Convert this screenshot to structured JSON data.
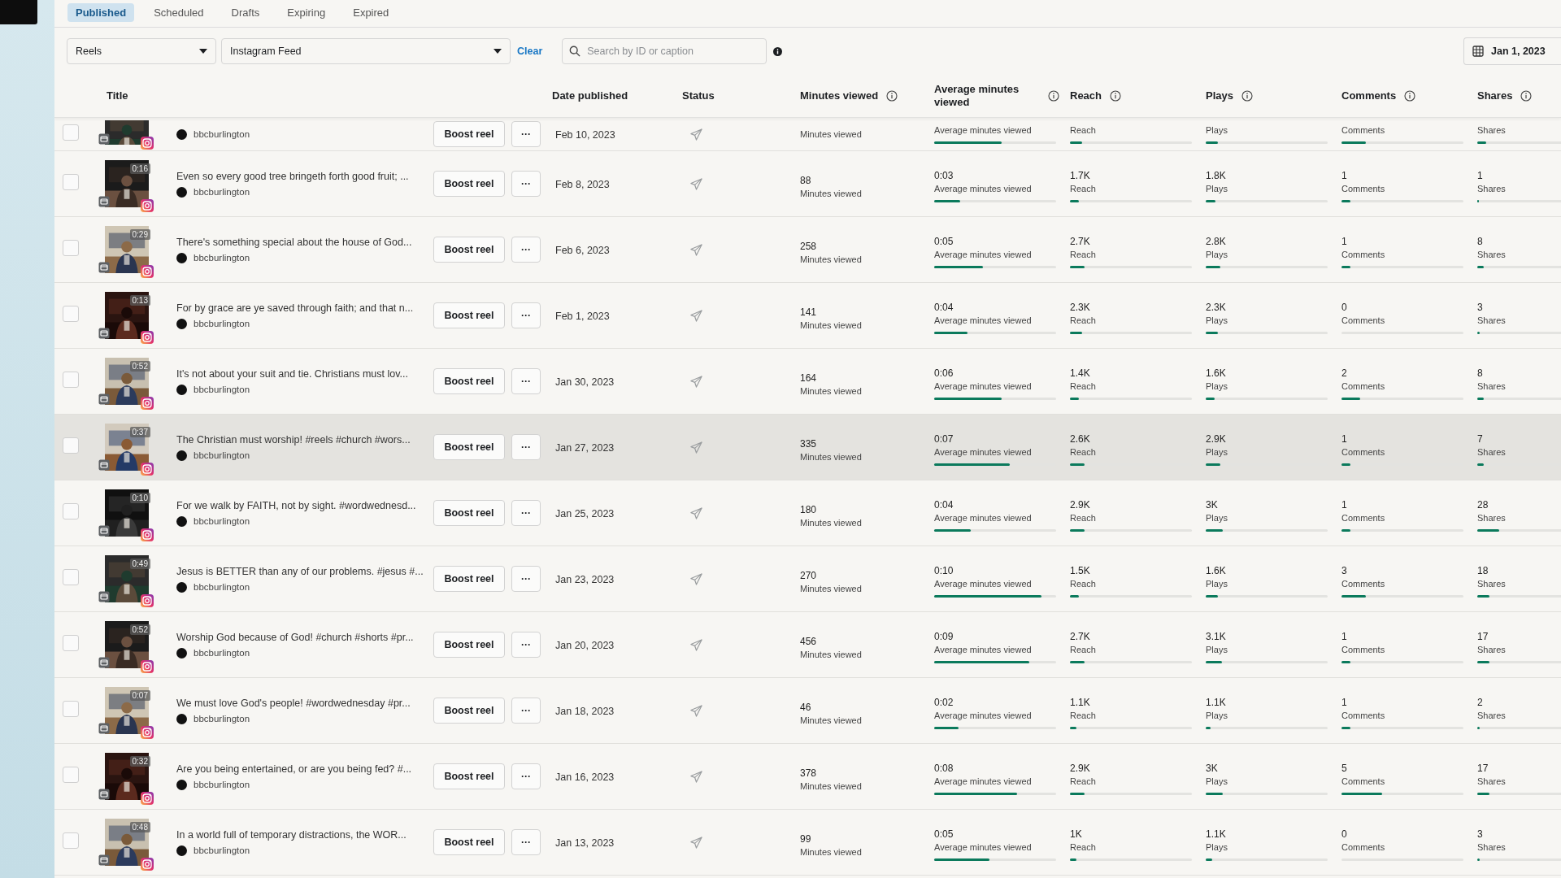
{
  "tabs": [
    {
      "label": "Published",
      "selected": true
    },
    {
      "label": "Scheduled",
      "selected": false
    },
    {
      "label": "Drafts",
      "selected": false
    },
    {
      "label": "Expiring",
      "selected": false
    },
    {
      "label": "Expired",
      "selected": false
    }
  ],
  "filters": {
    "content_type": "Reels",
    "placement": "Instagram Feed",
    "clear": "Clear",
    "search": {
      "placeholder": "Search by ID or caption"
    },
    "date_range": "Jan 1, 2023"
  },
  "columns": [
    {
      "label": "Title",
      "info": false
    },
    {
      "label": "Date published",
      "info": false
    },
    {
      "label": "Status",
      "info": false
    },
    {
      "label": "Minutes viewed",
      "info": true
    },
    {
      "label": "Average minutes viewed",
      "info": true
    },
    {
      "label": "Reach",
      "info": true
    },
    {
      "label": "Plays",
      "info": true
    },
    {
      "label": "Comments",
      "info": true
    },
    {
      "label": "Shares",
      "info": true
    }
  ],
  "rows": [
    {
      "checked": false,
      "highlighted": false,
      "account": "bbcburlington",
      "action": "Boost reel",
      "more": "···",
      "date": "Feb 10, 2023",
      "metrics": [
        {
          "label": "Minutes viewed"
        },
        {
          "label": "Average minutes viewed",
          "level": 0.55
        },
        {
          "label": "Reach",
          "level": 0.1
        },
        {
          "label": "Plays",
          "level": 0.1
        },
        {
          "label": "Comments",
          "level": 0.2
        },
        {
          "label": "Shares",
          "level": 0.07
        }
      ]
    },
    {
      "checked": false,
      "highlighted": false,
      "duration": "0:16",
      "title": "Even so every good tree bringeth forth good fruit; ...",
      "account": "bbcburlington",
      "action": "Boost reel",
      "more": "···",
      "date": "Feb 8, 2023",
      "metrics": [
        {
          "value": "88",
          "label": "Minutes viewed"
        },
        {
          "value": "0:03",
          "label": "Average minutes viewed",
          "level": 0.21
        },
        {
          "value": "1.7K",
          "label": "Reach",
          "level": 0.07
        },
        {
          "value": "1.8K",
          "label": "Plays",
          "level": 0.08
        },
        {
          "value": "1",
          "label": "Comments",
          "level": 0.07
        },
        {
          "value": "1",
          "label": "Shares",
          "level": 0.01
        }
      ]
    },
    {
      "checked": false,
      "highlighted": false,
      "duration": "0:29",
      "title": "There's something special about the house of God...",
      "account": "bbcburlington",
      "action": "Boost reel",
      "more": "···",
      "date": "Feb 6, 2023",
      "metrics": [
        {
          "value": "258",
          "label": "Minutes viewed"
        },
        {
          "value": "0:05",
          "label": "Average minutes viewed",
          "level": 0.4
        },
        {
          "value": "2.7K",
          "label": "Reach",
          "level": 0.12
        },
        {
          "value": "2.8K",
          "label": "Plays",
          "level": 0.12
        },
        {
          "value": "1",
          "label": "Comments",
          "level": 0.07
        },
        {
          "value": "8",
          "label": "Shares",
          "level": 0.05
        }
      ]
    },
    {
      "checked": false,
      "highlighted": false,
      "duration": "0:13",
      "title": "For by grace are ye saved through faith; and that n...",
      "account": "bbcburlington",
      "action": "Boost reel",
      "more": "···",
      "date": "Feb 1, 2023",
      "metrics": [
        {
          "value": "141",
          "label": "Minutes viewed"
        },
        {
          "value": "0:04",
          "label": "Average minutes viewed",
          "level": 0.27
        },
        {
          "value": "2.3K",
          "label": "Reach",
          "level": 0.1
        },
        {
          "value": "2.3K",
          "label": "Plays",
          "level": 0.1
        },
        {
          "value": "0",
          "label": "Comments"
        },
        {
          "value": "3",
          "label": "Shares",
          "level": 0.02
        }
      ]
    },
    {
      "checked": false,
      "highlighted": false,
      "duration": "0:52",
      "title": "It's not about your suit and tie. Christians must lov...",
      "account": "bbcburlington",
      "action": "Boost reel",
      "more": "···",
      "date": "Jan 30, 2023",
      "metrics": [
        {
          "value": "164",
          "label": "Minutes viewed"
        },
        {
          "value": "0:06",
          "label": "Average minutes viewed",
          "level": 0.55
        },
        {
          "value": "1.4K",
          "label": "Reach",
          "level": 0.07
        },
        {
          "value": "1.6K",
          "label": "Plays",
          "level": 0.07
        },
        {
          "value": "2",
          "label": "Comments",
          "level": 0.15
        },
        {
          "value": "8",
          "label": "Shares",
          "level": 0.05
        }
      ]
    },
    {
      "checked": false,
      "highlighted": true,
      "duration": "0:37",
      "title": "The Christian must worship! #reels #church #wors...",
      "account": "bbcburlington",
      "action": "Boost reel",
      "more": "···",
      "date": "Jan 27, 2023",
      "metrics": [
        {
          "value": "335",
          "label": "Minutes viewed"
        },
        {
          "value": "0:07",
          "label": "Average minutes viewed",
          "level": 0.62
        },
        {
          "value": "2.6K",
          "label": "Reach",
          "level": 0.12
        },
        {
          "value": "2.9K",
          "label": "Plays",
          "level": 0.12
        },
        {
          "value": "1",
          "label": "Comments",
          "level": 0.07
        },
        {
          "value": "7",
          "label": "Shares",
          "level": 0.05
        }
      ]
    },
    {
      "checked": false,
      "highlighted": false,
      "duration": "0:10",
      "title": "For we walk by FAITH, not by sight. #wordwednesd...",
      "account": "bbcburlington",
      "action": "Boost reel",
      "more": "···",
      "date": "Jan 25, 2023",
      "metrics": [
        {
          "value": "180",
          "label": "Minutes viewed"
        },
        {
          "value": "0:04",
          "label": "Average minutes viewed",
          "level": 0.3
        },
        {
          "value": "2.9K",
          "label": "Reach",
          "level": 0.12
        },
        {
          "value": "3K",
          "label": "Plays",
          "level": 0.14
        },
        {
          "value": "1",
          "label": "Comments",
          "level": 0.07
        },
        {
          "value": "28",
          "label": "Shares",
          "level": 0.18
        }
      ]
    },
    {
      "checked": false,
      "highlighted": false,
      "duration": "0:49",
      "title": "Jesus is BETTER than any of our problems. #jesus #...",
      "account": "bbcburlington",
      "action": "Boost reel",
      "more": "···",
      "date": "Jan 23, 2023",
      "metrics": [
        {
          "value": "270",
          "label": "Minutes viewed"
        },
        {
          "value": "0:10",
          "label": "Average minutes viewed",
          "level": 0.88
        },
        {
          "value": "1.5K",
          "label": "Reach",
          "level": 0.07
        },
        {
          "value": "1.6K",
          "label": "Plays",
          "level": 0.1
        },
        {
          "value": "3",
          "label": "Comments",
          "level": 0.2
        },
        {
          "value": "18",
          "label": "Shares",
          "level": 0.1
        }
      ]
    },
    {
      "checked": false,
      "highlighted": false,
      "duration": "0:52",
      "title": "Worship God because of God! #church #shorts #pr...",
      "account": "bbcburlington",
      "action": "Boost reel",
      "more": "···",
      "date": "Jan 20, 2023",
      "metrics": [
        {
          "value": "456",
          "label": "Minutes viewed"
        },
        {
          "value": "0:09",
          "label": "Average minutes viewed",
          "level": 0.78
        },
        {
          "value": "2.7K",
          "label": "Reach",
          "level": 0.12
        },
        {
          "value": "3.1K",
          "label": "Plays",
          "level": 0.13
        },
        {
          "value": "1",
          "label": "Comments",
          "level": 0.07
        },
        {
          "value": "17",
          "label": "Shares",
          "level": 0.1
        }
      ]
    },
    {
      "checked": false,
      "highlighted": false,
      "duration": "0:07",
      "title": "We must love God's people! #wordwednesday #pr...",
      "account": "bbcburlington",
      "action": "Boost reel",
      "more": "···",
      "date": "Jan 18, 2023",
      "metrics": [
        {
          "value": "46",
          "label": "Minutes viewed"
        },
        {
          "value": "0:02",
          "label": "Average minutes viewed",
          "level": 0.2
        },
        {
          "value": "1.1K",
          "label": "Reach",
          "level": 0.05
        },
        {
          "value": "1.1K",
          "label": "Plays",
          "level": 0.04
        },
        {
          "value": "1",
          "label": "Comments",
          "level": 0.07
        },
        {
          "value": "2",
          "label": "Shares",
          "level": 0.02
        }
      ]
    },
    {
      "checked": false,
      "highlighted": false,
      "duration": "0:32",
      "title": "Are you being entertained, or are you being fed? #...",
      "account": "bbcburlington",
      "action": "Boost reel",
      "more": "···",
      "date": "Jan 16, 2023",
      "metrics": [
        {
          "value": "378",
          "label": "Minutes viewed"
        },
        {
          "value": "0:08",
          "label": "Average minutes viewed",
          "level": 0.68
        },
        {
          "value": "2.9K",
          "label": "Reach",
          "level": 0.12
        },
        {
          "value": "3K",
          "label": "Plays",
          "level": 0.14
        },
        {
          "value": "5",
          "label": "Comments",
          "level": 0.33
        },
        {
          "value": "17",
          "label": "Shares",
          "level": 0.1
        }
      ]
    },
    {
      "checked": false,
      "highlighted": false,
      "duration": "0:48",
      "title": "In a world full of temporary distractions, the WOR...",
      "account": "bbcburlington",
      "action": "Boost reel",
      "more": "···",
      "date": "Jan 13, 2023",
      "metrics": [
        {
          "value": "99",
          "label": "Minutes viewed"
        },
        {
          "value": "0:05",
          "label": "Average minutes viewed",
          "level": 0.45
        },
        {
          "value": "1K",
          "label": "Reach",
          "level": 0.05
        },
        {
          "value": "1.1K",
          "label": "Plays",
          "level": 0.05
        },
        {
          "value": "0",
          "label": "Comments"
        },
        {
          "value": "3",
          "label": "Shares",
          "level": 0.02
        }
      ]
    }
  ]
}
